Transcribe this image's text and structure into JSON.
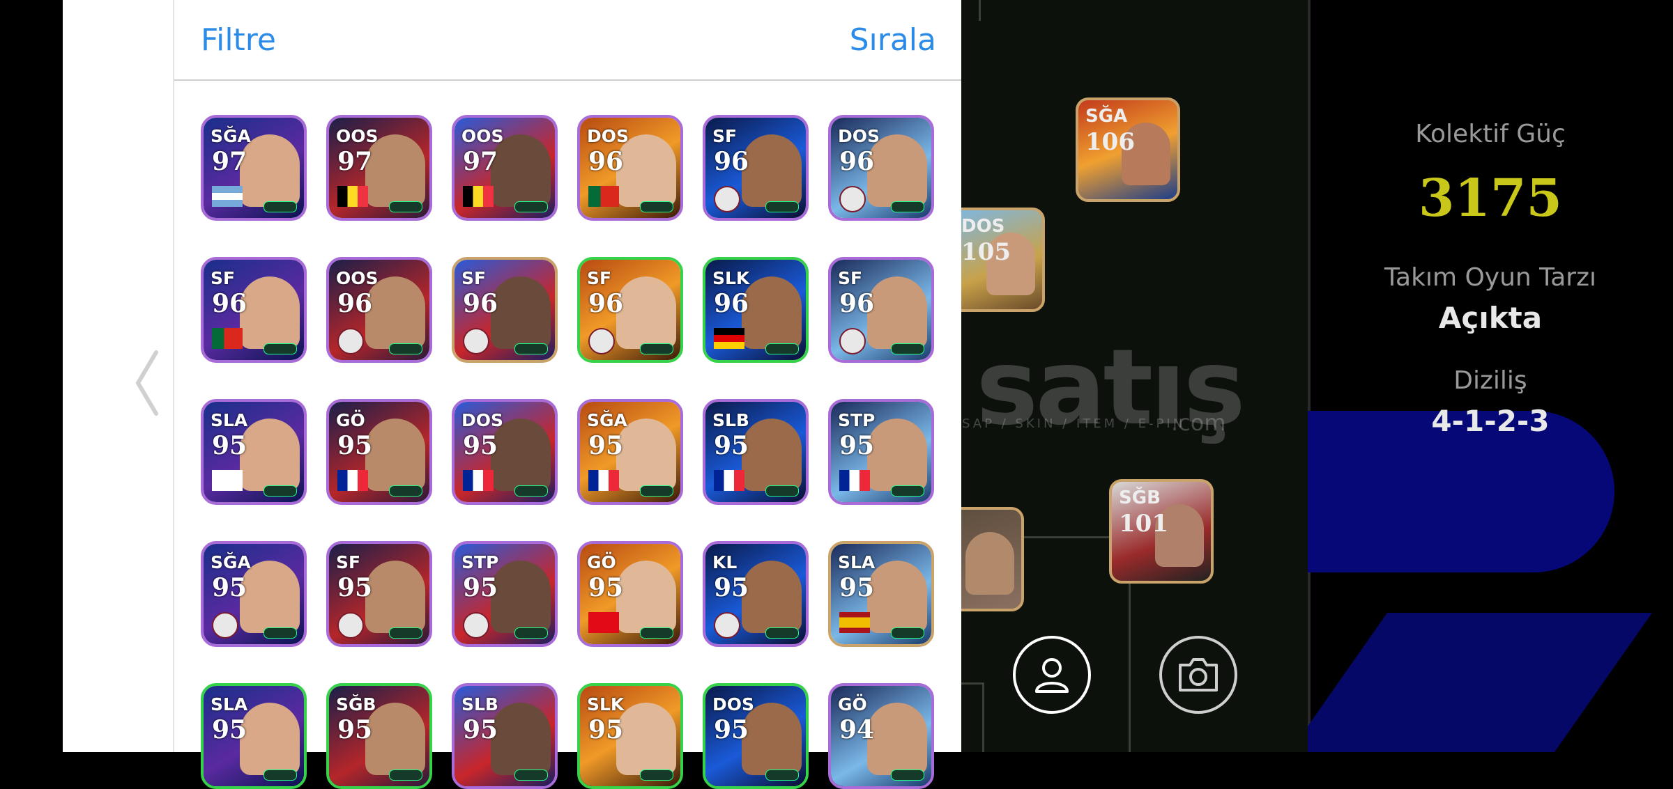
{
  "header": {
    "filter_label": "Filtre",
    "sort_label": "Sırala"
  },
  "players": [
    {
      "pos": "SĞA",
      "rating": "97",
      "flag": "argentina",
      "style": "purple"
    },
    {
      "pos": "OOS",
      "rating": "97",
      "flag": "belgium",
      "style": "purple"
    },
    {
      "pos": "OOS",
      "rating": "97",
      "flag": "belgium",
      "style": "purple"
    },
    {
      "pos": "DOS",
      "rating": "96",
      "flag": "portugal",
      "style": "purple"
    },
    {
      "pos": "SF",
      "rating": "96",
      "flag": "inter-badge",
      "style": "purple"
    },
    {
      "pos": "DOS",
      "rating": "96",
      "flag": "club-badge",
      "style": "purple"
    },
    {
      "pos": "SF",
      "rating": "96",
      "flag": "portugal",
      "style": "purple"
    },
    {
      "pos": "OOS",
      "rating": "96",
      "flag": "club-badge",
      "style": "purple"
    },
    {
      "pos": "SF",
      "rating": "96",
      "flag": "club-badge",
      "style": "gold"
    },
    {
      "pos": "SF",
      "rating": "96",
      "flag": "club-badge",
      "style": "green"
    },
    {
      "pos": "SLK",
      "rating": "96",
      "flag": "germany",
      "style": "green"
    },
    {
      "pos": "SF",
      "rating": "96",
      "flag": "club-badge",
      "style": "purple"
    },
    {
      "pos": "SLA",
      "rating": "95",
      "flag": "korea",
      "style": "purple"
    },
    {
      "pos": "GÖ",
      "rating": "95",
      "flag": "france",
      "style": "purple"
    },
    {
      "pos": "DOS",
      "rating": "95",
      "flag": "france",
      "style": "purple"
    },
    {
      "pos": "SĞA",
      "rating": "95",
      "flag": "france",
      "style": "purple"
    },
    {
      "pos": "SLB",
      "rating": "95",
      "flag": "france",
      "style": "purple"
    },
    {
      "pos": "STP",
      "rating": "95",
      "flag": "france",
      "style": "purple"
    },
    {
      "pos": "SĞA",
      "rating": "95",
      "flag": "club-badge",
      "style": "purple"
    },
    {
      "pos": "SF",
      "rating": "95",
      "flag": "barcelona-badge",
      "style": "purple"
    },
    {
      "pos": "STP",
      "rating": "95",
      "flag": "club-badge",
      "style": "purple"
    },
    {
      "pos": "GÖ",
      "rating": "95",
      "flag": "turkey",
      "style": "purple"
    },
    {
      "pos": "KL",
      "rating": "95",
      "flag": "barcelona-badge",
      "style": "purple"
    },
    {
      "pos": "SLA",
      "rating": "95",
      "flag": "spain",
      "style": "gold"
    },
    {
      "pos": "SLA",
      "rating": "95",
      "flag": "none",
      "style": "green"
    },
    {
      "pos": "SĞB",
      "rating": "95",
      "flag": "none",
      "style": "green"
    },
    {
      "pos": "SLB",
      "rating": "95",
      "flag": "none",
      "style": "purple"
    },
    {
      "pos": "SLK",
      "rating": "95",
      "flag": "none",
      "style": "green"
    },
    {
      "pos": "DOS",
      "rating": "95",
      "flag": "none",
      "style": "green"
    },
    {
      "pos": "GÖ",
      "rating": "94",
      "flag": "none",
      "style": "purple"
    }
  ],
  "formation_cards": [
    {
      "pos": "SĞA",
      "rating": "106"
    },
    {
      "pos": "DOS",
      "rating": "105"
    },
    {
      "pos": "SĞB",
      "rating": "101"
    }
  ],
  "watermark": {
    "main": "satış",
    "sub": "SAP / SKIN / ITEM / E-PIN",
    "domain": ".com"
  },
  "stats": {
    "collective_label": "Kolektif Güç",
    "collective_value": "3175",
    "style_label": "Takım Oyun Tarzı",
    "style_value": "Açıkta",
    "formation_label": "Diziliş",
    "formation_value": "4-1-2-3"
  },
  "colors": {
    "accent": "#2a8be8",
    "power": "#c9c81a",
    "deco_blue": "#050876"
  },
  "icons": {
    "back": "chevron-left-icon",
    "profile": "user-icon",
    "camera": "camera-icon"
  }
}
